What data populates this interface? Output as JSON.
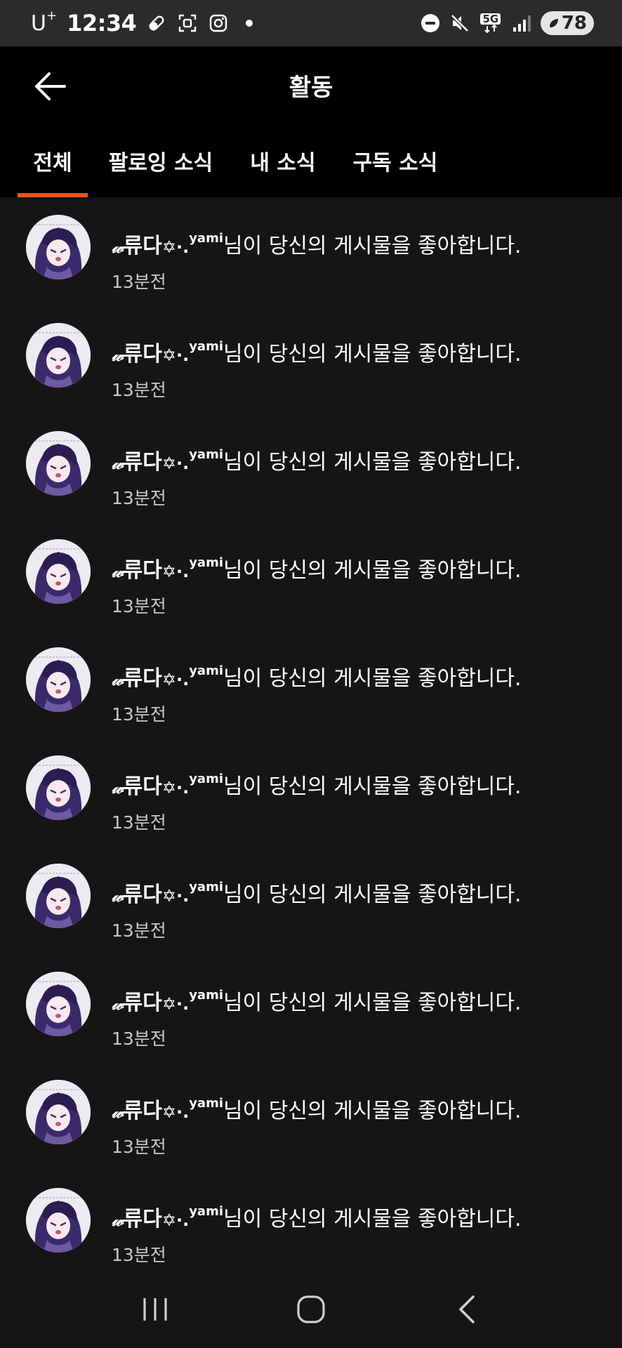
{
  "statusbar": {
    "carrier": "U",
    "carrier_sup": "+",
    "time": "12:34",
    "network": "5G",
    "battery": "78"
  },
  "header": {
    "title": "활동"
  },
  "tabs": [
    {
      "label": "전체",
      "active": true
    },
    {
      "label": "팔로잉 소식",
      "active": false
    },
    {
      "label": "내 소식",
      "active": false
    },
    {
      "label": "구독 소식",
      "active": false
    }
  ],
  "notifications": [
    {
      "user_prefix": "𝓌",
      "user_main": "류다",
      "user_star": "✡·.",
      "user_sup": "yami",
      "message": "님이 당신의 게시물을 좋아합니다.",
      "time": "13분전"
    },
    {
      "user_prefix": "𝓌",
      "user_main": "류다",
      "user_star": "✡·.",
      "user_sup": "yami",
      "message": "님이 당신의 게시물을 좋아합니다.",
      "time": "13분전"
    },
    {
      "user_prefix": "𝓌",
      "user_main": "류다",
      "user_star": "✡·.",
      "user_sup": "yami",
      "message": "님이 당신의 게시물을 좋아합니다.",
      "time": "13분전"
    },
    {
      "user_prefix": "𝓌",
      "user_main": "류다",
      "user_star": "✡·.",
      "user_sup": "yami",
      "message": "님이 당신의 게시물을 좋아합니다.",
      "time": "13분전"
    },
    {
      "user_prefix": "𝓌",
      "user_main": "류다",
      "user_star": "✡·.",
      "user_sup": "yami",
      "message": "님이 당신의 게시물을 좋아합니다.",
      "time": "13분전"
    },
    {
      "user_prefix": "𝓌",
      "user_main": "류다",
      "user_star": "✡·.",
      "user_sup": "yami",
      "message": "님이 당신의 게시물을 좋아합니다.",
      "time": "13분전"
    },
    {
      "user_prefix": "𝓌",
      "user_main": "류다",
      "user_star": "✡·.",
      "user_sup": "yami",
      "message": "님이 당신의 게시물을 좋아합니다.",
      "time": "13분전"
    },
    {
      "user_prefix": "𝓌",
      "user_main": "류다",
      "user_star": "✡·.",
      "user_sup": "yami",
      "message": "님이 당신의 게시물을 좋아합니다.",
      "time": "13분전"
    },
    {
      "user_prefix": "𝓌",
      "user_main": "류다",
      "user_star": "✡·.",
      "user_sup": "yami",
      "message": "님이 당신의 게시물을 좋아합니다.",
      "time": "13분전"
    },
    {
      "user_prefix": "𝓌",
      "user_main": "류다",
      "user_star": "✡·.",
      "user_sup": "yami",
      "message": "님이 당신의 게시물을 좋아합니다.",
      "time": "13분전"
    }
  ],
  "colors": {
    "accent": "#f4511e",
    "background": "#151515",
    "header": "#000000",
    "statusbar": "#2b2b2b"
  }
}
